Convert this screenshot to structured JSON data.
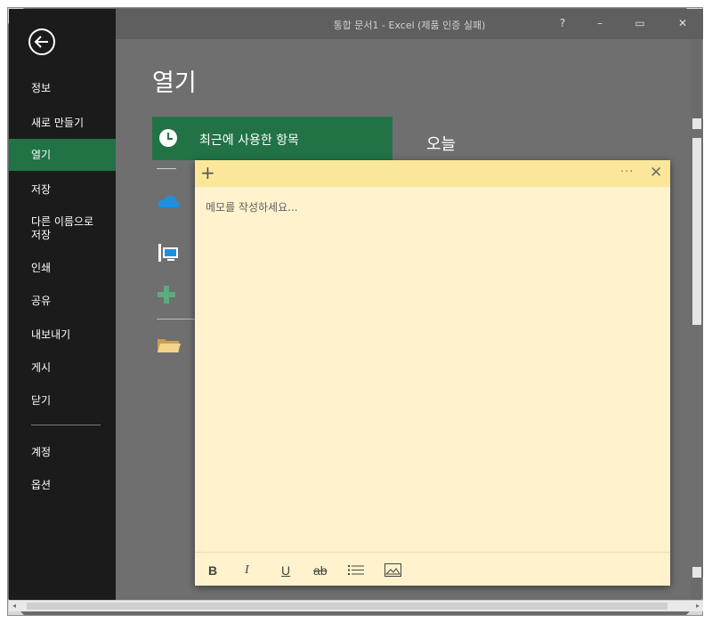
{
  "window": {
    "title": "통합 문서1 - Excel (제품 인증 실패)",
    "controls": {
      "help": "?",
      "minimize": "–",
      "restore": "▭",
      "close": "✕"
    }
  },
  "sidebar": {
    "items": [
      {
        "label": "정보",
        "active": false
      },
      {
        "label": "새로 만들기",
        "active": false
      },
      {
        "label": "열기",
        "active": true
      },
      {
        "label": "저장",
        "active": false
      },
      {
        "label": "다른 이름으로\n저장",
        "active": false
      },
      {
        "label": "인쇄",
        "active": false
      },
      {
        "label": "공유",
        "active": false
      },
      {
        "label": "내보내기",
        "active": false
      },
      {
        "label": "게시",
        "active": false
      },
      {
        "label": "닫기",
        "active": false
      }
    ],
    "footer_items": [
      {
        "label": "계정"
      },
      {
        "label": "옵션"
      }
    ]
  },
  "main": {
    "title": "열기",
    "locations": [
      {
        "label": "최근에 사용한 항목",
        "icon": "clock-icon",
        "selected": true
      },
      {
        "label": "",
        "icon": "onedrive-cloud-icon"
      },
      {
        "label": "",
        "icon": "this-pc-icon"
      },
      {
        "label": "",
        "icon": "add-place-icon"
      },
      {
        "label": "",
        "icon": "browse-folder-icon"
      }
    ],
    "section_header": "오늘"
  },
  "sticky_note": {
    "placeholder": "메모를 작성하세요...",
    "value": "",
    "header": {
      "add_glyph": "+",
      "more_glyph": "···",
      "close_glyph": "✕"
    },
    "toolbar": {
      "bold": "B",
      "italic": "I",
      "underline": "U",
      "strikethrough": "ab",
      "list_icon": "bullet-list-icon",
      "image_icon": "insert-image-icon"
    },
    "background_color": "#fff2cc",
    "header_color": "#fbe79a"
  },
  "colors": {
    "accent_green": "#217346",
    "sidebar_bg": "#1b1b1b",
    "content_bg": "#6f6f6f"
  }
}
